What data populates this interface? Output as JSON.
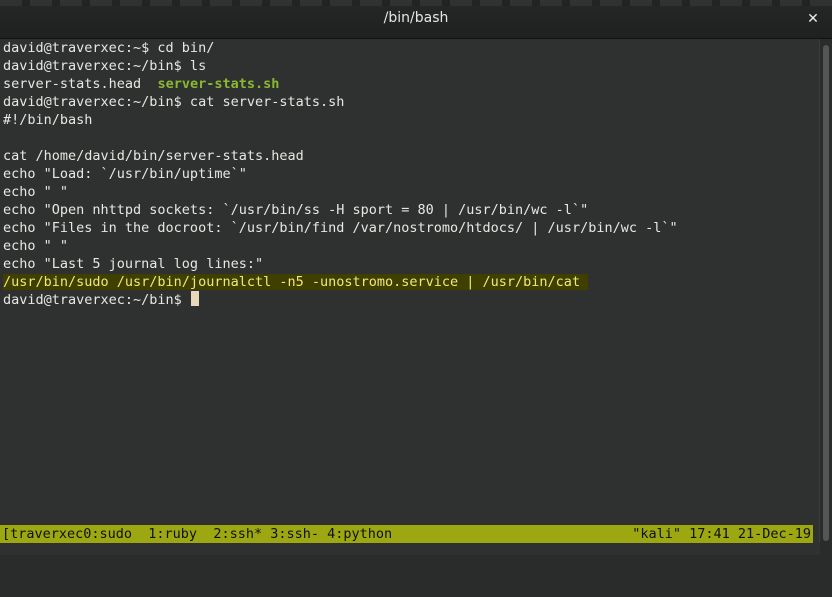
{
  "window": {
    "title": "/bin/bash",
    "close_label": "✕"
  },
  "terminal": {
    "lines": [
      "david@traverxec:~$ cd bin/",
      "david@traverxec:~/bin$ ls",
      "server-stats.head  ",
      "david@traverxec:~/bin$ cat server-stats.sh",
      "#!/bin/bash",
      "",
      "cat /home/david/bin/server-stats.head",
      "echo \"Load: `/usr/bin/uptime`\"",
      "echo \" \"",
      "echo \"Open nhttpd sockets: `/usr/bin/ss -H sport = 80 | /usr/bin/wc -l`\"",
      "echo \"Files in the docroot: `/usr/bin/find /var/nostromo/htdocs/ | /usr/bin/wc -l`\"",
      "echo \" \"",
      "echo \"Last 5 journal log lines:\"",
      "/usr/bin/sudo /usr/bin/journalctl -n5 -unostromo.service | /usr/bin/cat ",
      "david@traverxec:~/bin$ "
    ],
    "ls_executable": "server-stats.sh"
  },
  "statusbar": {
    "left": "[traverxec0:sudo  1:ruby  2:ssh* 3:ssh- 4:python",
    "right": "\"kali\" 17:41 21-Dec-19"
  },
  "colors": {
    "background": "#2f3131",
    "text": "#e8e8e2",
    "executable": "#8ab82e",
    "highlight_bg": "#3f3f00",
    "highlight_text": "#f0e87a",
    "statusbar": "#9da711"
  }
}
